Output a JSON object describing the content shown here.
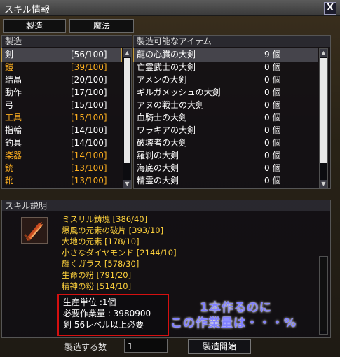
{
  "window": {
    "title": "スキル情報",
    "close_label": "X"
  },
  "tabs": [
    {
      "label": "製造"
    },
    {
      "label": "魔法"
    }
  ],
  "skills_panel": {
    "header": "製造",
    "items": [
      {
        "name": "剣",
        "value": "[56/100]",
        "color": "#ffffff"
      },
      {
        "name": "鎧",
        "value": "[39/100]",
        "color": "#ffb020"
      },
      {
        "name": "結晶",
        "value": "[20/100]",
        "color": "#ffffff"
      },
      {
        "name": "動作",
        "value": "[17/100]",
        "color": "#ffffff"
      },
      {
        "name": "弓",
        "value": "[15/100]",
        "color": "#ffffff"
      },
      {
        "name": "工具",
        "value": "[15/100]",
        "color": "#ffb020"
      },
      {
        "name": "指輪",
        "value": "[14/100]",
        "color": "#ffffff"
      },
      {
        "name": "釣具",
        "value": "[14/100]",
        "color": "#ffffff"
      },
      {
        "name": "楽器",
        "value": "[14/100]",
        "color": "#ffb020"
      },
      {
        "name": "銃",
        "value": "[13/100]",
        "color": "#ffb020"
      },
      {
        "name": "靴",
        "value": "[13/100]",
        "color": "#ffb020"
      }
    ],
    "selected_index": 0
  },
  "items_panel": {
    "header": "製造可能なアイテム",
    "items": [
      {
        "name": "龍の心臓の大剣",
        "qty": "9 個"
      },
      {
        "name": "亡霊武士の大剣",
        "qty": "0 個"
      },
      {
        "name": "アメンの大剣",
        "qty": "0 個"
      },
      {
        "name": "ギルガメッシュの大剣",
        "qty": "0 個"
      },
      {
        "name": "アヌの戦士の大剣",
        "qty": "0 個"
      },
      {
        "name": "血騎士の大剣",
        "qty": "0 個"
      },
      {
        "name": "ワラキアの大剣",
        "qty": "0 個"
      },
      {
        "name": "破壊者の大剣",
        "qty": "0 個"
      },
      {
        "name": "羅刹の大剣",
        "qty": "0 個"
      },
      {
        "name": "海底の大剣",
        "qty": "0 個"
      },
      {
        "name": "精霊の大剣",
        "qty": "0 個"
      }
    ],
    "selected_index": 0
  },
  "description": {
    "header": "スキル説明",
    "materials": [
      "ミスリル鋳塊 [386/40]",
      "爆風の元素の破片 [393/10]",
      "大地の元素 [178/10]",
      "小さなダイヤモンド [2144/10]",
      "輝くガラス [578/30]",
      "生命の粉 [791/20]",
      "精神の粉 [514/10]"
    ],
    "info": {
      "unit": "生産単位 :1個",
      "work": "必要作業量 : 3980900",
      "requirement": "剣 56レベル以上必要"
    },
    "annotation_line1": "1本作るのに",
    "annotation_line2": "この作業量は・・・%"
  },
  "footer": {
    "qty_label": "製造する数",
    "qty_value": "1",
    "start_label": "製造開始"
  },
  "colors": {
    "highlight_text": "#ffb020",
    "material_text": "#ffd23c",
    "annotation": "#8080ff",
    "info_border": "#d41010"
  }
}
